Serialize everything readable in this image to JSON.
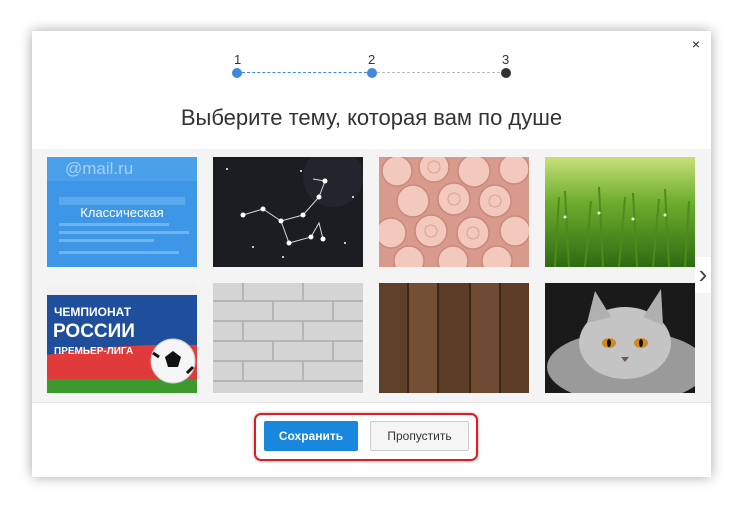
{
  "dialog": {
    "close_label": "×",
    "steps": [
      "1",
      "2",
      "3"
    ],
    "title": "Выберите тему, которая вам по душе"
  },
  "themes": [
    {
      "label": "Классическая",
      "logo": "@mail.ru",
      "kind": "classic"
    },
    {
      "kind": "constellation"
    },
    {
      "kind": "roses"
    },
    {
      "kind": "grass"
    },
    {
      "kind": "football",
      "lines": [
        "ЧЕМПИОНАТ",
        "РОССИИ",
        "ПРЕМЬЕР-ЛИГА"
      ]
    },
    {
      "kind": "brick"
    },
    {
      "kind": "wood"
    },
    {
      "kind": "cat"
    }
  ],
  "buttons": {
    "save": "Сохранить",
    "skip": "Пропустить"
  },
  "icons": {
    "next": "chevron-right-icon",
    "close": "close-icon"
  },
  "colors": {
    "primary": "#1a87df",
    "highlight": "#d81e27",
    "step_active": "#3f8ad8"
  }
}
